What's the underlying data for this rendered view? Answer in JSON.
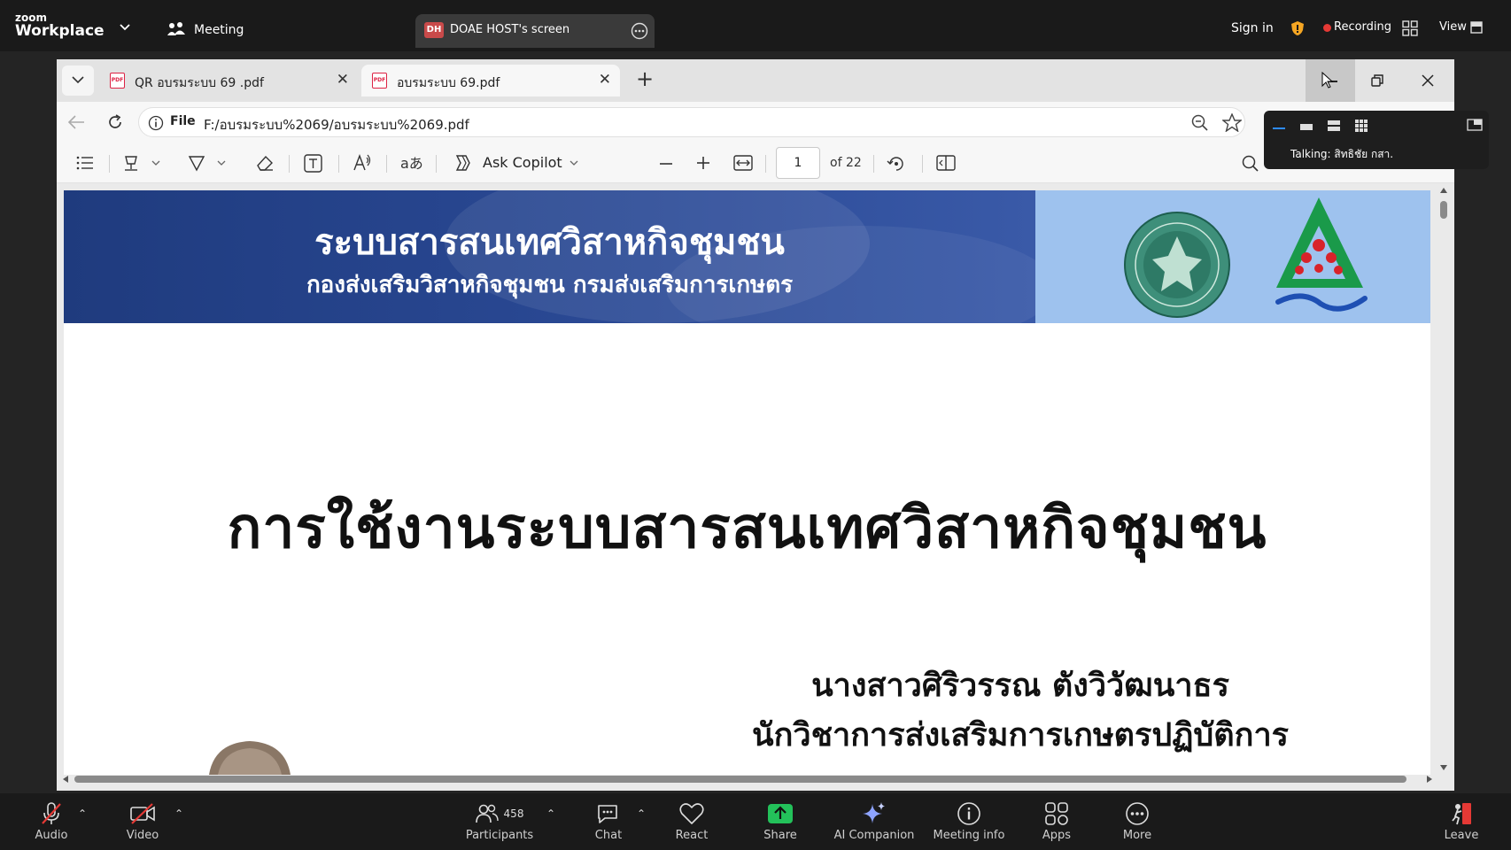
{
  "zoom": {
    "logo_small": "zoom",
    "logo_large": "Workplace",
    "meeting_label": "Meeting",
    "share_badge": "DH",
    "share_title": "DOAE HOST's screen",
    "sign_in": "Sign in",
    "recording": "Recording",
    "view": "View"
  },
  "browser": {
    "tabs": [
      {
        "label": "QR อบรมระบบ 69 .pdf",
        "active": false
      },
      {
        "label": "อบรมระบบ 69.pdf",
        "active": true
      }
    ],
    "address_prefix": "File",
    "address_url": "F:/อบรมระบบ%2069/อบรมระบบ%2069.pdf"
  },
  "pdf_toolbar": {
    "ask_copilot": "Ask Copilot",
    "page_current": "1",
    "page_total": "of 22"
  },
  "floating_panel": {
    "talking": "Talking: สิทธิชัย กสา."
  },
  "document": {
    "banner_title": "ระบบสารสนเทศวิสาหกิจชุมชน",
    "banner_subtitle": "กองส่งเสริมวิสาหกิจชุมชน กรมส่งเสริมการเกษตร",
    "main_title": "การใช้งานระบบสารสนเทศวิสาหกิจชุมชน",
    "presenter_name": "นางสาวศิริวรรณ ตังวิวัฒนาธร",
    "presenter_role": "นักวิชาการส่งเสริมการเกษตรปฏิบัติการ"
  },
  "bottom_bar": {
    "audio": "Audio",
    "video": "Video",
    "participants": "Participants",
    "participants_count": "458",
    "chat": "Chat",
    "react": "React",
    "share": "Share",
    "ai_companion": "AI Companion",
    "meeting_info": "Meeting info",
    "apps": "Apps",
    "more": "More",
    "leave": "Leave"
  },
  "colors": {
    "zoom_bg": "#1a1a1a",
    "banner_blue": "#1f3b7e",
    "banner_light": "#9ec2ee",
    "share_green": "#23c15a",
    "recording_red": "#e53935"
  }
}
